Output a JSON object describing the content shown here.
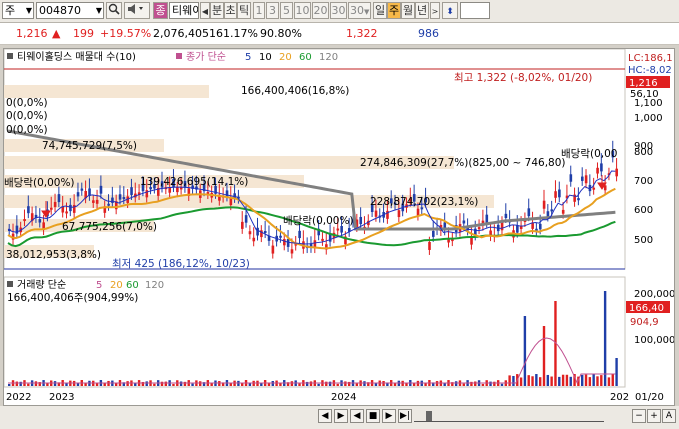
{
  "toolbar": {
    "market_label": "주",
    "code": "004870",
    "search_icon": "magnifier-icon",
    "sound_icon": "speaker-icon",
    "stock_badge": "종",
    "stock_name": "티웨이",
    "period_label": "분",
    "period_items": [
      "초",
      "틱",
      "1",
      "3",
      "5",
      "10",
      "20",
      "30",
      "30"
    ],
    "range_items": [
      "일",
      "주",
      "월",
      "년"
    ],
    "active_range": "주"
  },
  "infobar": {
    "price": "1,216",
    "change_arrow": "▲",
    "change": "199",
    "change_pct": "+19.57%",
    "volume": "2,076,405",
    "volume_ratio": "161.17%",
    "strength": "90.80%",
    "high_price": "1,322",
    "last_field": "986"
  },
  "chart": {
    "price_legend": "티웨이홀딩스 매물대 수(10)",
    "ma_legend_label": "종가 단순",
    "ma_periods": [
      "5",
      "10",
      "20",
      "60",
      "120"
    ],
    "ma_colors": [
      "#1f3ea8",
      "#2030c0",
      "#e8a020",
      "#1a9a30",
      "#808080"
    ],
    "volume_profile": [
      {
        "label": "166,400,406(16,8%)"
      },
      {
        "label": "0(0,0%)"
      },
      {
        "label": "0(0,0%)"
      },
      {
        "label": "0(0,0%)"
      },
      {
        "label": "74,745,729(7,5%)"
      },
      {
        "label": "274,846,309(27,7%)(825,00 ~ 746,80)"
      },
      {
        "label": "139,426,695(14,1%)"
      },
      {
        "label": "228,874,702(23,1%)"
      },
      {
        "label": "67,775,256(7,0%)"
      },
      {
        "label": "38,012,953(3,8%)"
      }
    ],
    "annotations": {
      "high": "최고 1,322 (-8,02%, 01/20)",
      "low": "최저 425 (186,12%, 10/23)",
      "dividend": "배당락(0,00%)",
      "dividend2": "배당락(0,00%)",
      "dividend3": "배당락(0,00"
    },
    "right_axis": {
      "top_labels": [
        "LC:186,1",
        "HC:-8,02"
      ],
      "current_price": "1,216",
      "extra": "56,10",
      "ticks": [
        "1,100",
        "1,000",
        "900",
        "800",
        "700",
        "600",
        "500"
      ]
    },
    "volume_legend_label": "거래량 단순",
    "volume_ma_periods": [
      "5",
      "20",
      "60",
      "120"
    ],
    "volume_value": "166,400,406주(904,99%)",
    "volume_axis": {
      "ticks": [
        "200,000",
        "100,000"
      ],
      "current": "166,40",
      "current_pct": "904,9"
    },
    "x_labels": [
      "2022",
      "2023",
      "2024",
      "202",
      "01/20"
    ]
  },
  "colors": {
    "up": "#e02020",
    "down": "#1f3ea8",
    "profile": "#f5e6d3",
    "toolbar_active": "#f7b94a"
  }
}
